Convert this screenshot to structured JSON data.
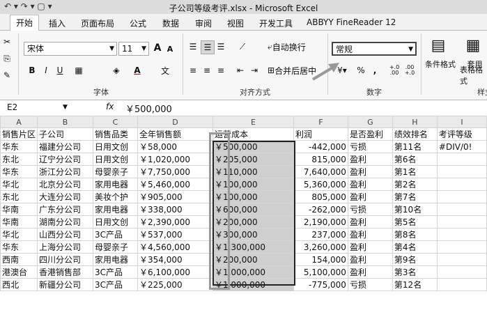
{
  "window": {
    "title": "子公司等级考评.xlsx - Microsoft Excel"
  },
  "tabs": [
    "开始",
    "插入",
    "页面布局",
    "公式",
    "数据",
    "审阅",
    "视图",
    "开发工具",
    "ABBYY FineReader 12"
  ],
  "ribbon": {
    "font_name": "宋体",
    "font_size": "11",
    "grow_font": "A",
    "shrink_font": "A",
    "bold": "B",
    "italic": "I",
    "underline": "U",
    "wrap_text": "自动换行",
    "merge_center": "合并后居中",
    "number_format": "常规",
    "percent": "%",
    "comma": ",",
    "inc_decimal": "+.0 .00",
    "dec_decimal": ".00 +.0",
    "conditional_format": "条件格式",
    "table_format_1": "套用",
    "table_format_2": "表格格式",
    "groups": {
      "font": "字体",
      "alignment": "对齐方式",
      "number": "数字",
      "styles": "样式"
    }
  },
  "formula_bar": {
    "cell": "E2",
    "fx": "fx",
    "value": "￥500,000"
  },
  "columns": [
    "A",
    "B",
    "C",
    "D",
    "E",
    "F",
    "G",
    "H",
    "I"
  ],
  "header_row": [
    "销售片区",
    "子公司",
    "销售品类",
    "全年销售额",
    "运营成本",
    "利润",
    "是否盈利",
    "绩效排名",
    "考评等级"
  ],
  "rows": [
    [
      "华东",
      "福建分公司",
      "日用文创",
      "￥58,000",
      "￥500,000",
      "-442,000",
      "亏损",
      "第11名",
      "#DIV/0!"
    ],
    [
      "东北",
      "辽宁分公司",
      "日用文创",
      "￥1,020,000",
      "￥205,000",
      "815,000",
      "盈利",
      "第6名",
      ""
    ],
    [
      "华东",
      "浙江分公司",
      "母婴亲子",
      "￥7,750,000",
      "￥110,000",
      "7,640,000",
      "盈利",
      "第1名",
      ""
    ],
    [
      "华北",
      "北京分公司",
      "家用电器",
      "￥5,460,000",
      "￥100,000",
      "5,360,000",
      "盈利",
      "第2名",
      ""
    ],
    [
      "东北",
      "大连分公司",
      "美妆个护",
      "￥905,000",
      "￥100,000",
      "805,000",
      "盈利",
      "第7名",
      ""
    ],
    [
      "华南",
      "广东分公司",
      "家用电器",
      "￥338,000",
      "￥600,000",
      "-262,000",
      "亏损",
      "第10名",
      ""
    ],
    [
      "华南",
      "湖南分公司",
      "日用文创",
      "￥2,390,000",
      "￥200,000",
      "2,190,000",
      "盈利",
      "第5名",
      ""
    ],
    [
      "华北",
      "山西分公司",
      "3C产品",
      "￥537,000",
      "￥300,000",
      "237,000",
      "盈利",
      "第8名",
      ""
    ],
    [
      "华东",
      "上海分公司",
      "母婴亲子",
      "￥4,560,000",
      "￥1,300,000",
      "3,260,000",
      "盈利",
      "第4名",
      ""
    ],
    [
      "西南",
      "四川分公司",
      "家用电器",
      "￥354,000",
      "￥200,000",
      "154,000",
      "盈利",
      "第9名",
      ""
    ],
    [
      "港澳台",
      "香港销售部",
      "3C产品",
      "￥6,100,000",
      "￥1,000,000",
      "5,100,000",
      "盈利",
      "第3名",
      ""
    ],
    [
      "西北",
      "新疆分公司",
      "3C产品",
      "￥225,000",
      "￥1,000,000",
      "-775,000",
      "亏损",
      "第12名",
      ""
    ]
  ]
}
